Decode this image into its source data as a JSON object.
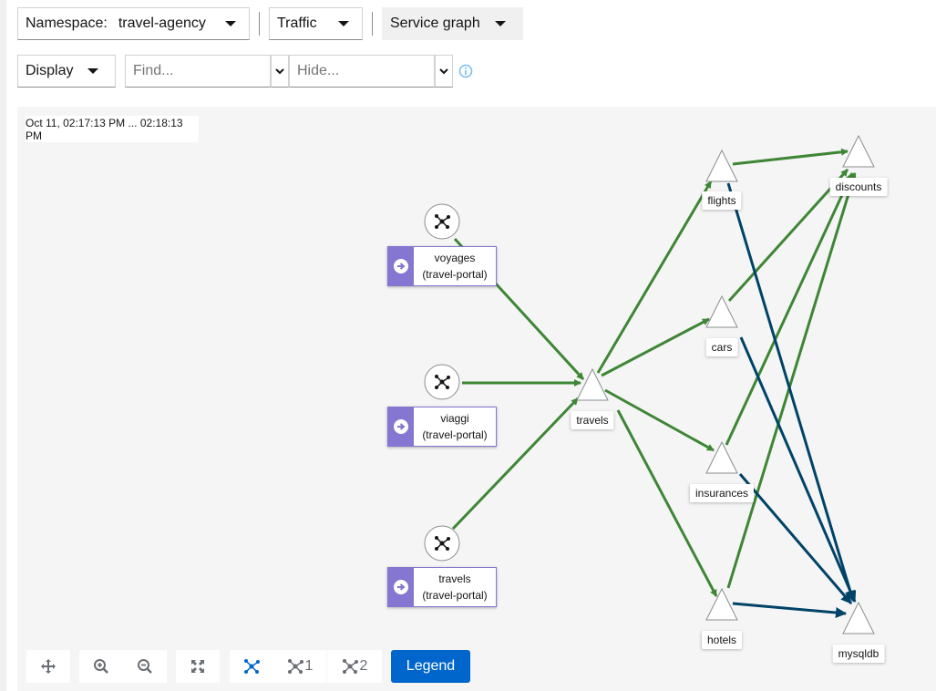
{
  "toolbar": {
    "namespace_label": "Namespace:",
    "namespace_value": "travel-agency",
    "traffic_label": "Traffic",
    "graph_type": "Service graph",
    "display_label": "Display",
    "find_placeholder": "Find...",
    "hide_placeholder": "Hide..."
  },
  "graph": {
    "time_range": "Oct 11, 02:17:13 PM ... 02:18:13 PM",
    "workloads": [
      {
        "name": "voyages",
        "app": "(travel-portal)"
      },
      {
        "name": "viaggi",
        "app": "(travel-portal)"
      },
      {
        "name": "travels",
        "app": "(travel-portal)"
      }
    ],
    "services": [
      "travels",
      "flights",
      "cars",
      "insurances",
      "hotels",
      "discounts",
      "mysqldb"
    ],
    "edge_colors": {
      "http": "#3e8635",
      "tcp": "#004368"
    }
  },
  "controls": {
    "hop1_label": "1",
    "hop2_label": "2",
    "legend_label": "Legend"
  },
  "colors": {
    "accent": "#0066cc",
    "workload": "#8476d1",
    "info": "#73bcf7"
  }
}
